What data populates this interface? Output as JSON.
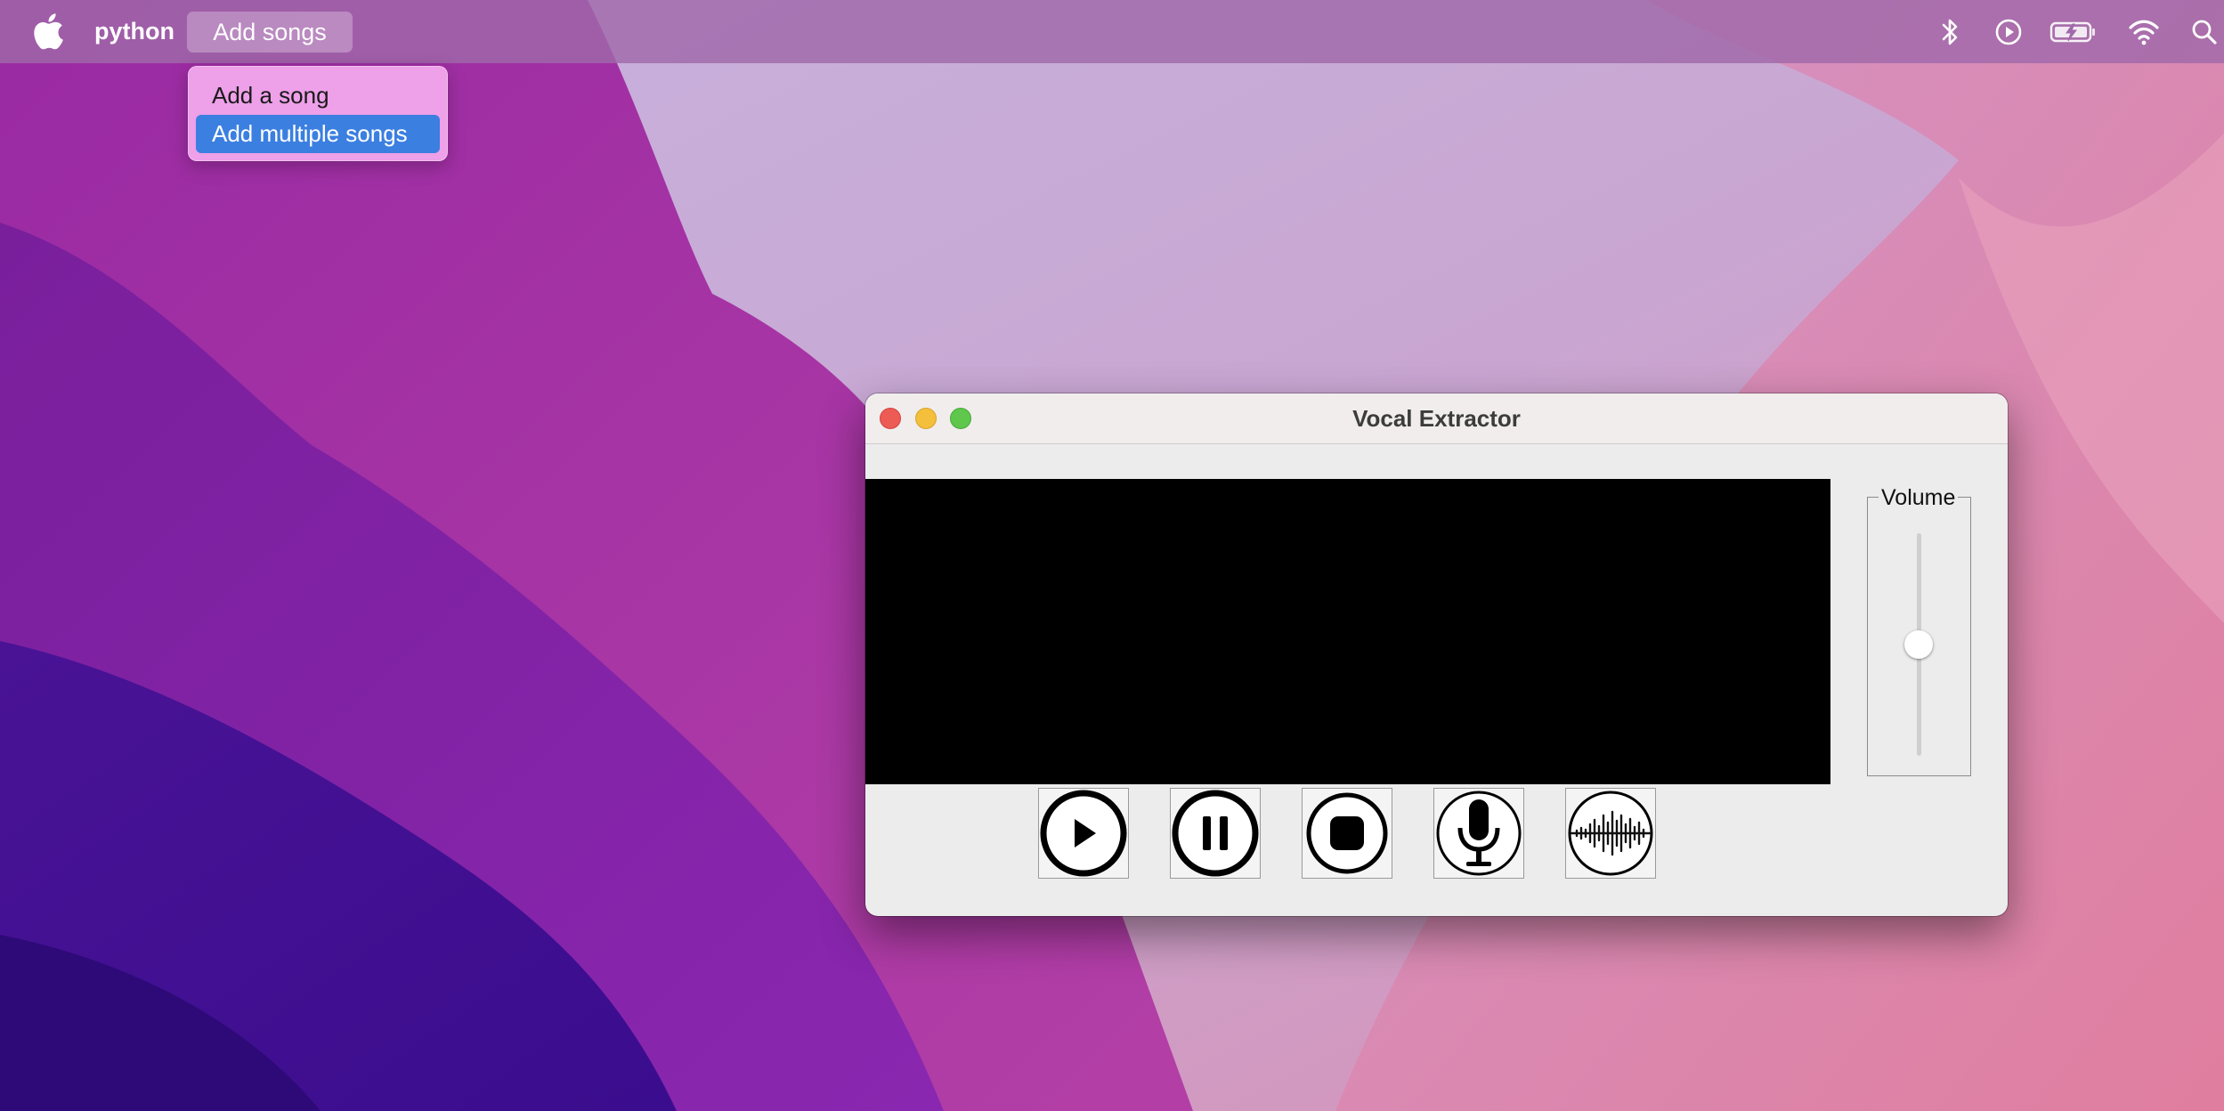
{
  "menubar": {
    "app_name": "python",
    "menu_title": "Add songs",
    "status_icons": [
      "bluetooth-icon",
      "play-circle-icon",
      "battery-charging-icon",
      "wifi-icon",
      "search-icon"
    ]
  },
  "dropdown": {
    "items": [
      {
        "label": "Add a song",
        "highlighted": false
      },
      {
        "label": "Add multiple songs",
        "highlighted": true
      }
    ]
  },
  "window": {
    "title": "Vocal Extractor",
    "volume_label": "Volume",
    "volume_level": 0.5,
    "controls": [
      "play-button",
      "pause-button",
      "stop-button",
      "microphone-button",
      "waveform-button"
    ]
  },
  "colors": {
    "menubar": "#a069aa",
    "dropdown": "#eea0e9",
    "highlight": "#3b7fe0",
    "window_bg": "#ececec",
    "display": "#000000"
  }
}
